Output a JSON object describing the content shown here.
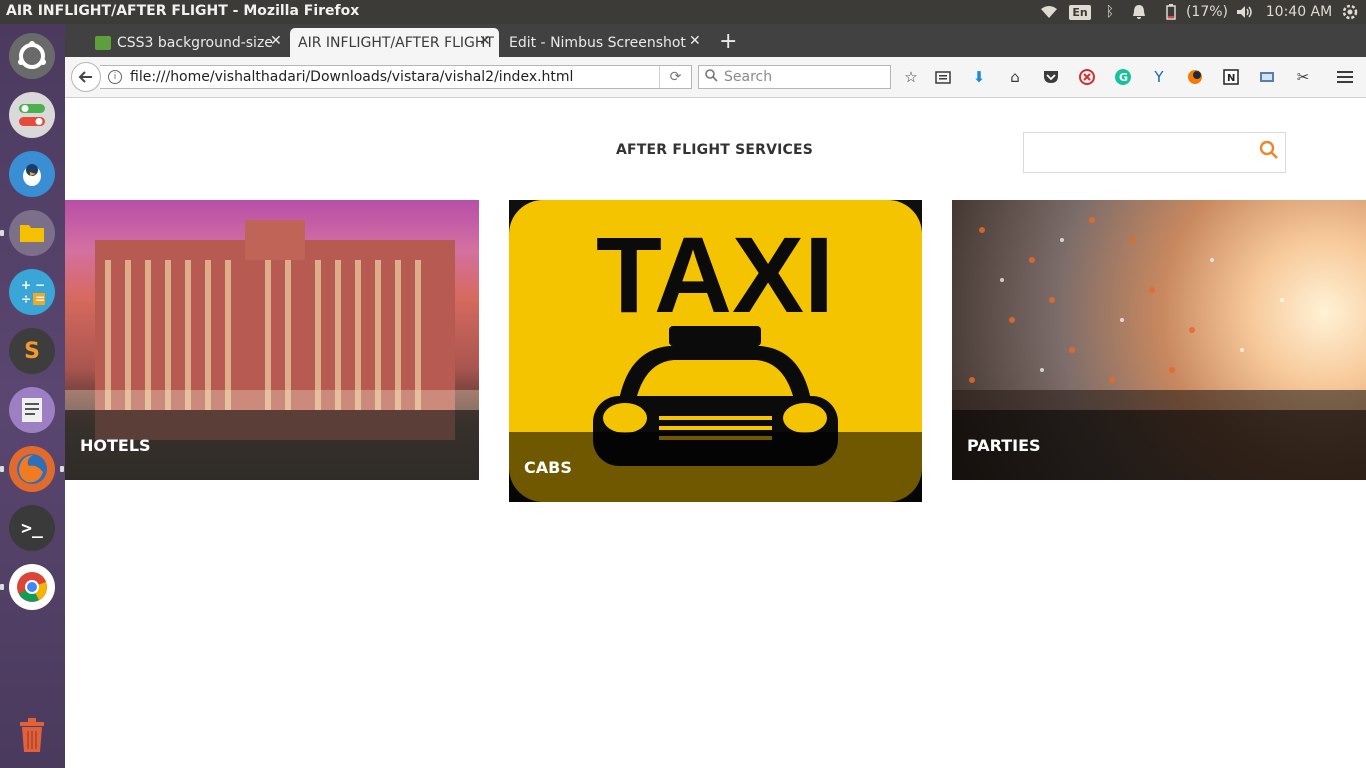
{
  "system_panel": {
    "window_title": "AIR INFLIGHT/AFTER FLIGHT - Mozilla Firefox",
    "language": "En",
    "battery": "(17%)",
    "clock": "10:40 AM"
  },
  "launcher": {
    "items": [
      "ubuntu-logo",
      "toggle-app",
      "messenger",
      "files",
      "calculator",
      "sublime-text",
      "text-editor",
      "firefox",
      "terminal",
      "chrome",
      "trash"
    ]
  },
  "browser": {
    "tabs": [
      {
        "label": "CSS3 background-size"
      },
      {
        "label": "AIR INFLIGHT/AFTER FLIGHT"
      },
      {
        "label": "Edit - Nimbus Screenshot"
      }
    ],
    "new_tab": "+",
    "url": "file:///home/vishalthadari/Downloads/vistara/vishal2/index.html",
    "search_placeholder": "Search"
  },
  "page": {
    "heading": "AFTER FLIGHT SERVICES",
    "search_value": "",
    "cards": [
      {
        "caption": "HOTELS"
      },
      {
        "caption": "CABS",
        "sign_text": "TAXI"
      },
      {
        "caption": "PARTIES"
      }
    ]
  },
  "colors": {
    "taxi_yellow": "#f5c400",
    "search_accent": "#e8892d",
    "panel": "#3c3b37"
  }
}
